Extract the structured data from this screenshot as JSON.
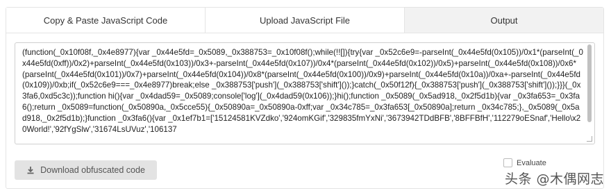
{
  "tabs": [
    {
      "label": "Copy & Paste JavaScript Code",
      "active": false
    },
    {
      "label": "Upload JavaScript File",
      "active": false
    },
    {
      "label": "Output",
      "active": true
    }
  ],
  "output": {
    "code": "(function(_0x10f08f,_0x4e8977){var _0x44e5fd=_0x5089,_0x388753=_0x10f08f();while(!![]){try{var _0x52c6e9=-parseInt(_0x44e5fd(0x105))/0x1*(parseInt(_0x44e5fd(0xff))/0x2)+parseInt(_0x44e5fd(0x103))/0x3+-parseInt(_0x44e5fd(0x107))/0x4*(parseInt(_0x44e5fd(0x102))/0x5)+parseInt(_0x44e5fd(0x108))/0x6*(parseInt(_0x44e5fd(0x101))/0x7)+parseInt(_0x44e5fd(0x104))/0x8*(parseInt(_0x44e5fd(0x100))/0x9)+parseInt(_0x44e5fd(0x10a))/0xa+-parseInt(_0x44e5fd(0x109))/0xb;if(_0x52c6e9===_0x4e8977)break;else _0x388753['push'](_0x388753['shift']());}catch(_0x50f12f){_0x388753['push'](_0x388753['shift']());}}}(_0x3fa6,0xd5c3c));function hi(){var _0x4dad59=_0x5089;console['log'](_0x4dad59(0x106));}hi();function _0x5089(_0x5ad918,_0x2f5d1b){var _0x3fa653=_0x3fa6();return _0x5089=function(_0x50890a,_0x5cce55){_0x50890a=_0x50890a-0xff;var _0x34c785=_0x3fa653[_0x50890a];return _0x34c785;},_0x5089(_0x5ad918,_0x2f5d1b);}function _0x3fa6(){var _0x1ef7b1=['15124581KVZdko','924omKGif','329835fmYxNi','3673942TDdBFB','8BFFBfH','112279oESnaf','Hello\\x20World!','92fYgSlw','31674LsUVuz','106137"
  },
  "download_button": {
    "label": "Download obfuscated code",
    "icon": "download-icon"
  },
  "evaluate": {
    "label": "Evaluate"
  },
  "watermark": {
    "text": "头条 @木偶网志"
  },
  "colors": {
    "active_tab_bg": "#f2f2f2",
    "button_bg": "#e3e3e3",
    "border": "#e4e4e4"
  }
}
